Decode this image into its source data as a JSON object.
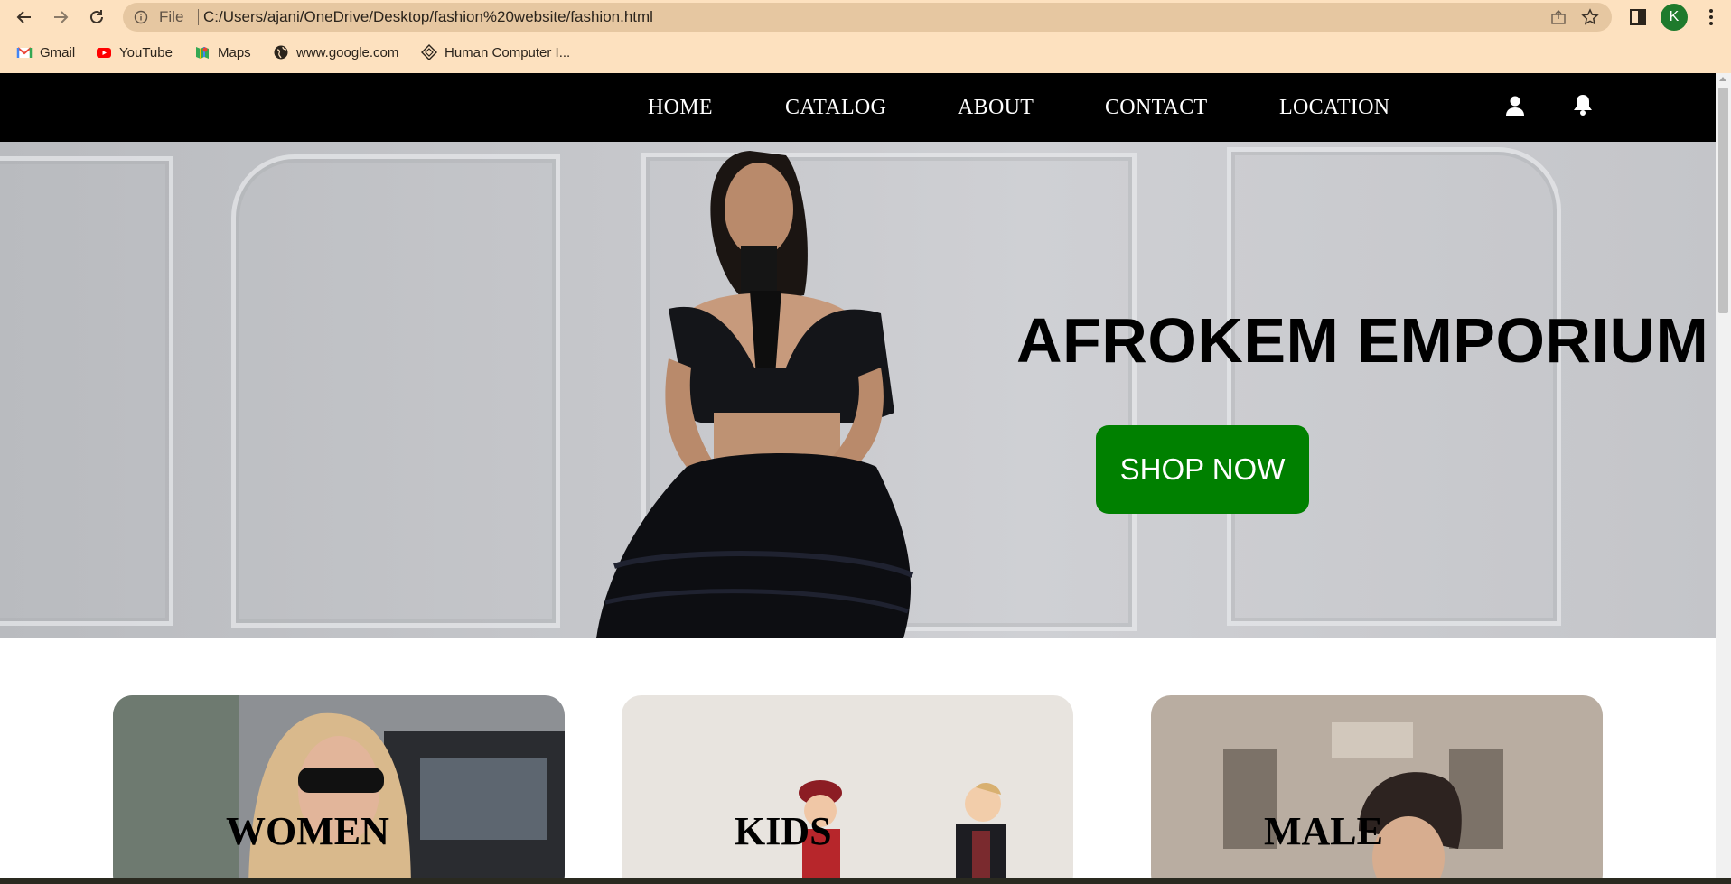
{
  "browser": {
    "scheme_label": "File",
    "url": "C:/Users/ajani/OneDrive/Desktop/fashion%20website/fashion.html",
    "profile_initial": "K",
    "bookmarks": [
      {
        "label": "Gmail",
        "icon": "gmail-icon"
      },
      {
        "label": "YouTube",
        "icon": "youtube-icon"
      },
      {
        "label": "Maps",
        "icon": "maps-icon"
      },
      {
        "label": "www.google.com",
        "icon": "globe-icon"
      },
      {
        "label": "Human Computer I...",
        "icon": "hci-site-icon"
      }
    ]
  },
  "site": {
    "nav": {
      "items": [
        {
          "label": "HOME"
        },
        {
          "label": "CATALOG"
        },
        {
          "label": "ABOUT"
        },
        {
          "label": "CONTACT"
        },
        {
          "label": "LOCATION"
        }
      ],
      "icons": [
        "user-icon",
        "bell-icon"
      ]
    },
    "hero": {
      "title": "AFROKEM EMPORIUM",
      "cta_label": "SHOP NOW"
    },
    "categories": [
      {
        "label": "WOMEN"
      },
      {
        "label": "KIDS"
      },
      {
        "label": "MALE"
      }
    ]
  },
  "colors": {
    "chrome_bg": "#fde1bf",
    "omnibox_bg": "#e6c7a1",
    "nav_bg": "#000000",
    "cta_bg": "#008000",
    "profile_bg": "#1e7a2c"
  }
}
